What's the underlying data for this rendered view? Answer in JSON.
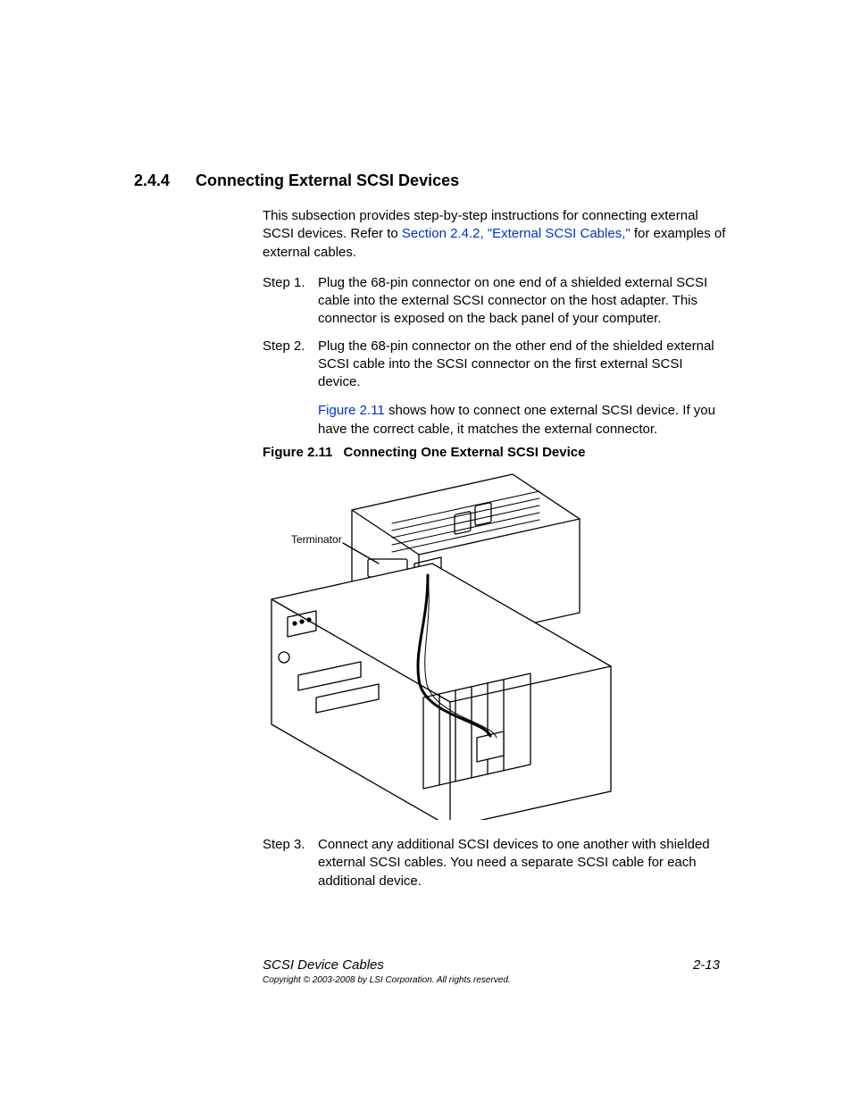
{
  "section": {
    "number": "2.4.4",
    "title": "Connecting External SCSI Devices"
  },
  "intro": {
    "part1": "This subsection provides step-by-step instructions for connecting external SCSI devices. Refer to ",
    "link": "Section 2.4.2, \"External SCSI Cables,\"",
    "part2": " for examples of external cables."
  },
  "steps": {
    "s1": {
      "label": "Step 1.",
      "text": "Plug the 68-pin connector on one end of a shielded external SCSI cable into the external SCSI connector on the host adapter. This connector is exposed on the back panel of your computer."
    },
    "s2": {
      "label": "Step 2.",
      "text": "Plug the 68-pin connector on the other end of the shielded external SCSI cable into the SCSI connector on the first external SCSI device.",
      "sub_link": "Figure 2.11",
      "sub_rest": " shows how to connect one external SCSI device. If you have the correct cable, it matches the external connector."
    },
    "s3": {
      "label": "Step 3.",
      "text": "Connect any additional SCSI devices to one another with shielded external SCSI cables. You need a separate SCSI cable for each additional device."
    }
  },
  "figure": {
    "label": "Figure 2.11",
    "caption": "Connecting One External SCSI Device",
    "annotation": "Terminator"
  },
  "footer": {
    "doc_title": "SCSI Device Cables",
    "page": "2-13",
    "copyright": "Copyright © 2003-2008 by LSI Corporation. All rights reserved."
  }
}
